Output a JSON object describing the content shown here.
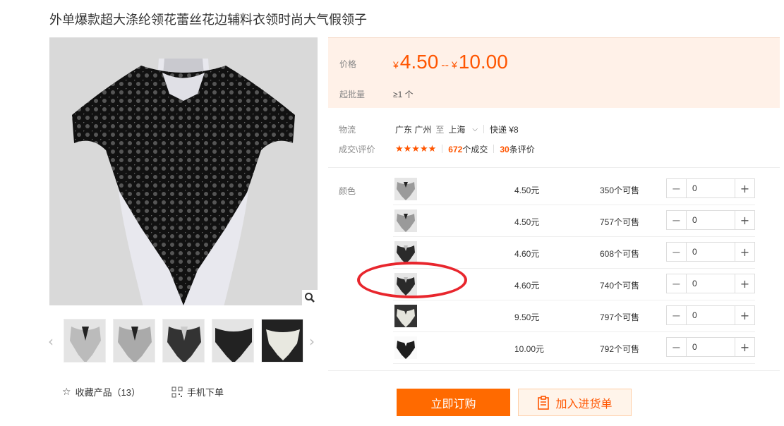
{
  "product": {
    "title": "外单爆款超大涤纶领花蕾丝花边辅料衣领时尚大气假领子"
  },
  "price": {
    "label": "价格",
    "currency": "¥",
    "min": "4.50",
    "separator": "--",
    "max": "10.00",
    "moq_label": "起批量",
    "moq_value": "≥1 个"
  },
  "logistics": {
    "label": "物流",
    "from": "广东 广州",
    "to_word": "至",
    "to": "上海",
    "shipping": "快递 ¥8"
  },
  "reviews": {
    "label": "成交\\评价",
    "stars": "★★★★★",
    "deals": "672",
    "deals_suffix": "个成交",
    "reviews": "30",
    "reviews_suffix": "条评价"
  },
  "sku": {
    "label": "颜色",
    "rows": [
      {
        "price": "4.50元",
        "stock": "350个可售",
        "qty": "0",
        "shade": "light"
      },
      {
        "price": "4.50元",
        "stock": "757个可售",
        "qty": "0",
        "shade": "light"
      },
      {
        "price": "4.60元",
        "stock": "608个可售",
        "qty": "0",
        "shade": "dark"
      },
      {
        "price": "4.60元",
        "stock": "740个可售",
        "qty": "0",
        "shade": "dark"
      },
      {
        "price": "9.50元",
        "stock": "797个可售",
        "qty": "0",
        "shade": "white"
      },
      {
        "price": "10.00元",
        "stock": "792个可售",
        "qty": "0",
        "shade": "black"
      }
    ]
  },
  "actions": {
    "favorite": "收藏产品（13）",
    "mobile": "手机下单",
    "buy": "立即订购",
    "cart": "加入进货单"
  },
  "colors": {
    "accent": "#ff5500",
    "highlight": "#e8262d",
    "price_bg": "#fff1e8"
  }
}
